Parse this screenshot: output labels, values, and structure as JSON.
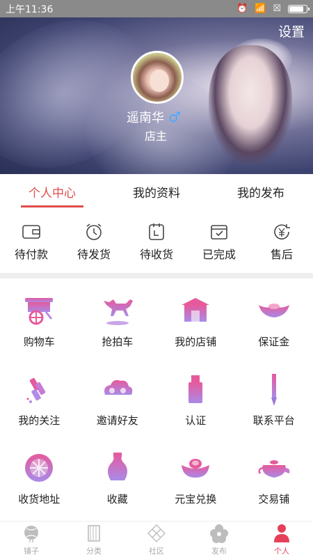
{
  "status_bar": {
    "time": "上午11:36",
    "battery_level": 0.85
  },
  "header": {
    "settings_label": "设置",
    "user_name": "遥南华",
    "gender_icon": "male-icon",
    "role": "店主"
  },
  "tabs": [
    {
      "label": "个人中心",
      "active": true
    },
    {
      "label": "我的资料",
      "active": false
    },
    {
      "label": "我的发布",
      "active": false
    }
  ],
  "orders": [
    {
      "label": "待付款",
      "icon": "wallet-icon"
    },
    {
      "label": "待发货",
      "icon": "alarm-clock-icon"
    },
    {
      "label": "待收货",
      "icon": "calendar-icon"
    },
    {
      "label": "已完成",
      "icon": "checked-box-icon"
    },
    {
      "label": "售后",
      "icon": "yen-refresh-icon"
    }
  ],
  "grid": [
    {
      "label": "购物车",
      "icon": "cart-icon"
    },
    {
      "label": "抢拍车",
      "icon": "horse-icon"
    },
    {
      "label": "我的店铺",
      "icon": "shop-icon"
    },
    {
      "label": "保证金",
      "icon": "ingot-icon"
    },
    {
      "label": "我的关注",
      "icon": "firecracker-icon"
    },
    {
      "label": "邀请好友",
      "icon": "cloud-icon"
    },
    {
      "label": "认证",
      "icon": "seal-icon"
    },
    {
      "label": "联系平台",
      "icon": "brush-icon"
    },
    {
      "label": "收货地址",
      "icon": "window-icon"
    },
    {
      "label": "收藏",
      "icon": "vase-icon"
    },
    {
      "label": "元宝兑换",
      "icon": "gold-ingot-icon"
    },
    {
      "label": "交易铺",
      "icon": "teapot-icon"
    }
  ],
  "tabbar": [
    {
      "label": "铺子",
      "icon": "lantern-icon",
      "active": false
    },
    {
      "label": "分类",
      "icon": "scroll-icon",
      "active": false
    },
    {
      "label": "社区",
      "icon": "knot-icon",
      "active": false
    },
    {
      "label": "发布",
      "icon": "flower-icon",
      "active": false
    },
    {
      "label": "个人",
      "icon": "person-icon",
      "active": true
    }
  ],
  "colors": {
    "accent": "#e24c4c",
    "icon_gradient_top": "#e75ea3",
    "icon_gradient_bottom": "#b28ce6",
    "tabbar_active": "#e63f5a"
  }
}
